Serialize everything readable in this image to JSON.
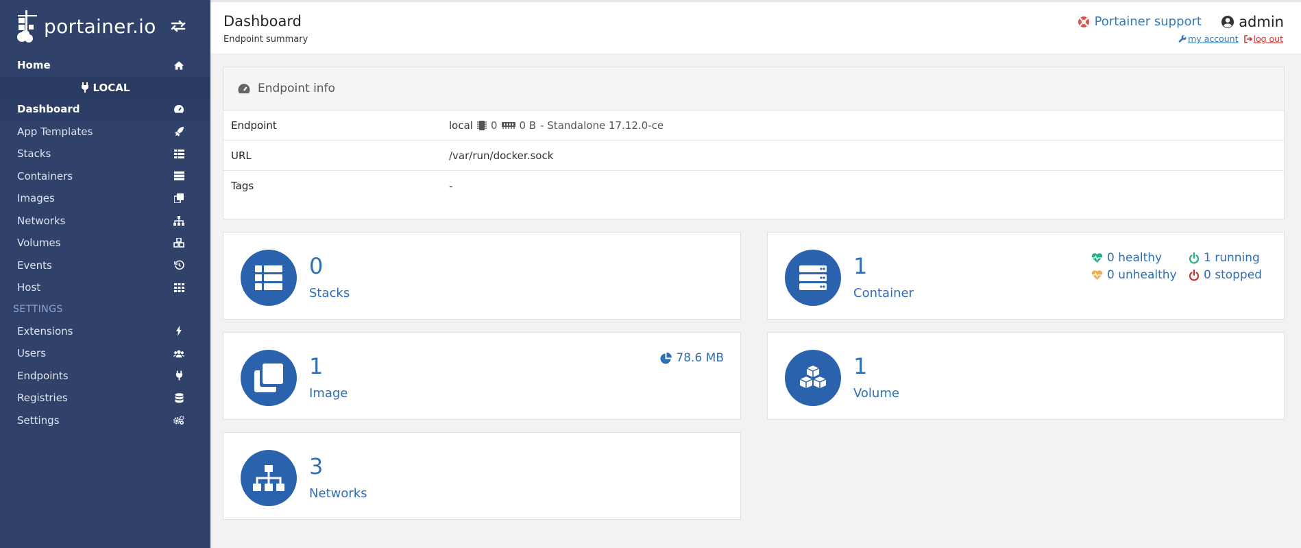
{
  "brand": {
    "name": "portainer.io"
  },
  "sidebar": {
    "home": "Home",
    "endpoint": "LOCAL",
    "items": [
      {
        "label": "Dashboard",
        "icon": "tachometer-icon",
        "active": true
      },
      {
        "label": "App Templates",
        "icon": "rocket-icon"
      },
      {
        "label": "Stacks",
        "icon": "th-list-icon"
      },
      {
        "label": "Containers",
        "icon": "server-icon"
      },
      {
        "label": "Images",
        "icon": "clone-icon"
      },
      {
        "label": "Networks",
        "icon": "sitemap-icon"
      },
      {
        "label": "Volumes",
        "icon": "cubes-icon"
      },
      {
        "label": "Events",
        "icon": "history-icon"
      },
      {
        "label": "Host",
        "icon": "th-icon"
      }
    ],
    "settings_title": "SETTINGS",
    "settings_items": [
      {
        "label": "Extensions",
        "icon": "bolt-icon"
      },
      {
        "label": "Users",
        "icon": "users-icon"
      },
      {
        "label": "Endpoints",
        "icon": "plug-icon"
      },
      {
        "label": "Registries",
        "icon": "database-icon"
      },
      {
        "label": "Settings",
        "icon": "cogs-icon"
      }
    ]
  },
  "header": {
    "title": "Dashboard",
    "subtitle": "Endpoint summary",
    "support": "Portainer support",
    "user": "admin",
    "my_account": "my account",
    "logout": "log out"
  },
  "endpoint_info": {
    "title": "Endpoint info",
    "rows": {
      "endpoint": {
        "key": "Endpoint",
        "name": "local",
        "cpu": "0",
        "memory": "0 B",
        "type": "- Standalone 17.12.0-ce"
      },
      "url": {
        "key": "URL",
        "value": "/var/run/docker.sock"
      },
      "tags": {
        "key": "Tags",
        "value": "-"
      }
    }
  },
  "tiles": {
    "stacks": {
      "count": "0",
      "label": "Stacks"
    },
    "containers": {
      "count": "1",
      "label": "Container",
      "healthy": "0 healthy",
      "unhealthy": "0 unhealthy",
      "running": "1 running",
      "stopped": "0 stopped"
    },
    "images": {
      "count": "1",
      "label": "Image",
      "size": "78.6 MB"
    },
    "volumes": {
      "count": "1",
      "label": "Volume"
    },
    "networks": {
      "count": "3",
      "label": "Networks"
    }
  },
  "colors": {
    "sidebar": "#30426a",
    "accent": "#2a62ad",
    "healthy": "#23ae89",
    "unhealthy": "#f0ad4e",
    "stopped": "#c9302c"
  }
}
